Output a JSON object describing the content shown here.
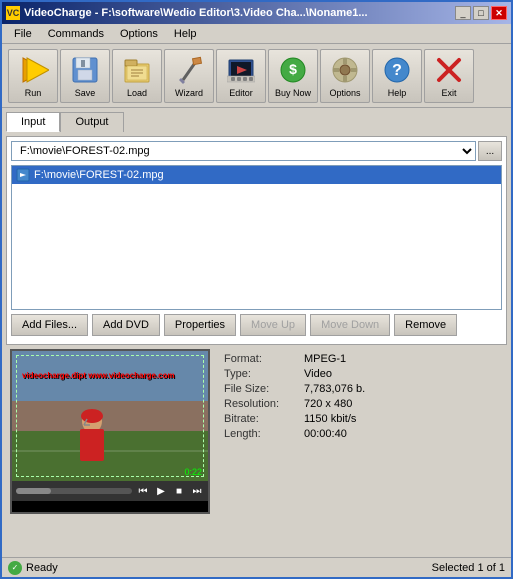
{
  "titlebar": {
    "title": "VideoCharge - F:\\software\\Wedio Editor\\3.Video Cha...\\Noname1...",
    "icon_label": "VC",
    "minimize_label": "_",
    "maximize_label": "□",
    "close_label": "✕"
  },
  "menubar": {
    "items": [
      {
        "id": "file",
        "label": "File"
      },
      {
        "id": "commands",
        "label": "Commands"
      },
      {
        "id": "options",
        "label": "Options"
      },
      {
        "id": "help",
        "label": "Help"
      }
    ]
  },
  "toolbar": {
    "buttons": [
      {
        "id": "run",
        "label": "Run",
        "icon": "▶"
      },
      {
        "id": "save",
        "label": "Save",
        "icon": "💾"
      },
      {
        "id": "load",
        "label": "Load",
        "icon": "📂"
      },
      {
        "id": "wizard",
        "label": "Wizard",
        "icon": "✏️"
      },
      {
        "id": "editor",
        "label": "Editor",
        "icon": "🎬"
      },
      {
        "id": "buy-now",
        "label": "Buy Now",
        "icon": "$"
      },
      {
        "id": "options",
        "label": "Options",
        "icon": "⚙"
      },
      {
        "id": "help",
        "label": "Help",
        "icon": "?"
      },
      {
        "id": "exit",
        "label": "Exit",
        "icon": "✕"
      }
    ]
  },
  "tabs": [
    {
      "id": "input",
      "label": "Input",
      "active": true
    },
    {
      "id": "output",
      "label": "Output",
      "active": false
    }
  ],
  "input": {
    "file_path": "F:\\movie\\FOREST-02.mpg",
    "file_list": [
      {
        "name": "F:\\movie\\FOREST-02.mpg",
        "selected": true
      }
    ],
    "buttons": {
      "add_files": "Add Files...",
      "add_dvd": "Add DVD",
      "properties": "Properties",
      "move_up": "Move Up",
      "move_down": "Move Down",
      "remove": "Remove"
    }
  },
  "video": {
    "timestamp": "0:22",
    "overlay_text": "videocharge.dipt\nwww.videocharge.com"
  },
  "file_info": {
    "format_label": "Format:",
    "format_value": "MPEG-1",
    "type_label": "Type:",
    "type_value": "Video",
    "file_size_label": "File Size:",
    "file_size_value": "7,783,076 b.",
    "resolution_label": "Resolution:",
    "resolution_value": "720 x 480",
    "bitrate_label": "Bitrate:",
    "bitrate_value": "1150 kbit/s",
    "length_label": "Length:",
    "length_value": "00:00:40"
  },
  "statusbar": {
    "left": "Ready",
    "right": "Selected 1 of 1"
  }
}
